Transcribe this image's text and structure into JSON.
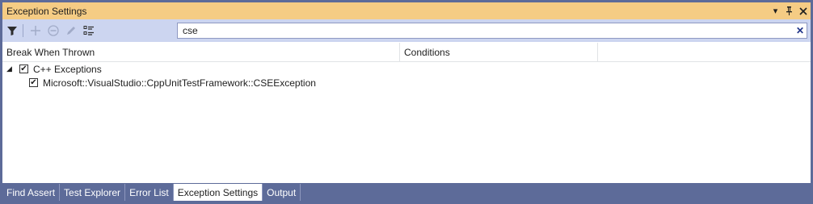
{
  "window": {
    "title": "Exception Settings"
  },
  "toolbar": {
    "filter_icon": "filter-icon",
    "add_icon": "add-icon",
    "remove_icon": "remove-icon",
    "edit_icon": "edit-icon",
    "list_icon": "list-options-icon"
  },
  "search": {
    "value": "cse",
    "clear_glyph": "✕"
  },
  "columns": {
    "break_when_thrown": "Break When Thrown",
    "conditions": "Conditions"
  },
  "rows": [
    {
      "label": "C++ Exceptions",
      "checked": true
    },
    {
      "label": "Microsoft::VisualStudio::CppUnitTestFramework::CSEException",
      "checked": true
    }
  ],
  "tabs": [
    {
      "label": "Find Assert"
    },
    {
      "label": "Test Explorer"
    },
    {
      "label": "Error List"
    },
    {
      "label": "Exception Settings"
    },
    {
      "label": "Output"
    }
  ],
  "colors": {
    "title_bar": "#f5cc84",
    "toolbar": "#ccd5f0",
    "tab_strip": "#5d6b99"
  }
}
